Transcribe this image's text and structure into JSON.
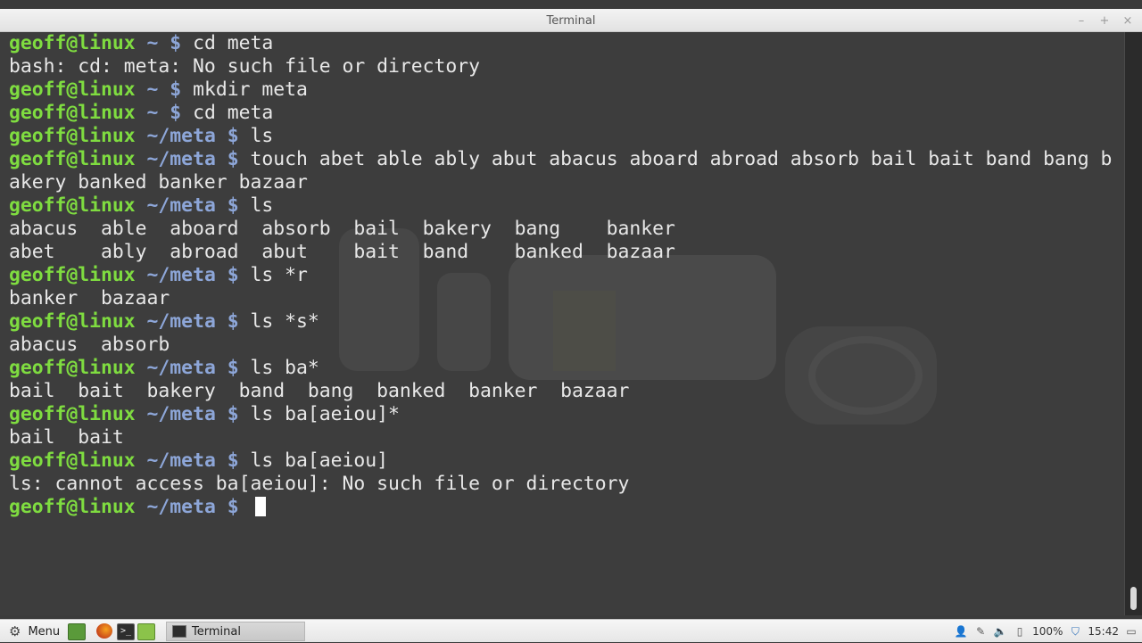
{
  "window": {
    "title": "Terminal",
    "controls": {
      "minimize": "–",
      "maximize": "+",
      "close": "×"
    }
  },
  "prompt": {
    "user": "geoff@linux"
  },
  "terminal": {
    "lines": [
      {
        "type": "prompt",
        "path": "~",
        "cmd": "cd meta"
      },
      {
        "type": "out",
        "text": "bash: cd: meta: No such file or directory"
      },
      {
        "type": "prompt",
        "path": "~",
        "cmd": "mkdir meta"
      },
      {
        "type": "prompt",
        "path": "~",
        "cmd": "cd meta"
      },
      {
        "type": "prompt",
        "path": "~/meta",
        "cmd": "ls"
      },
      {
        "type": "prompt",
        "path": "~/meta",
        "cmd": "touch abet able ably abut abacus aboard abroad absorb bail bait band bang b"
      },
      {
        "type": "out",
        "text": "akery banked banker bazaar"
      },
      {
        "type": "prompt",
        "path": "~/meta",
        "cmd": "ls"
      },
      {
        "type": "out",
        "text": "abacus  able  aboard  absorb  bail  bakery  bang    banker"
      },
      {
        "type": "out",
        "text": "abet    ably  abroad  abut    bait  band    banked  bazaar"
      },
      {
        "type": "prompt",
        "path": "~/meta",
        "cmd": "ls *r"
      },
      {
        "type": "out",
        "text": "banker  bazaar"
      },
      {
        "type": "prompt",
        "path": "~/meta",
        "cmd": "ls *s*"
      },
      {
        "type": "out",
        "text": "abacus  absorb"
      },
      {
        "type": "prompt",
        "path": "~/meta",
        "cmd": "ls ba*"
      },
      {
        "type": "out",
        "text": "bail  bait  bakery  band  bang  banked  banker  bazaar"
      },
      {
        "type": "prompt",
        "path": "~/meta",
        "cmd": "ls ba[aeiou]*"
      },
      {
        "type": "out",
        "text": "bail  bait"
      },
      {
        "type": "prompt",
        "path": "~/meta",
        "cmd": "ls ba[aeiou]"
      },
      {
        "type": "out",
        "text": "ls: cannot access ba[aeiou]: No such file or directory"
      },
      {
        "type": "prompt",
        "path": "~/meta",
        "cmd": "",
        "cursor": true
      }
    ]
  },
  "taskbar": {
    "menu_label": "Menu",
    "launchers": [
      "show-desktop-icon",
      "firefox-icon",
      "terminal-icon",
      "files-icon"
    ],
    "task_label": "Terminal",
    "battery": "100%",
    "clock": "15:42"
  }
}
